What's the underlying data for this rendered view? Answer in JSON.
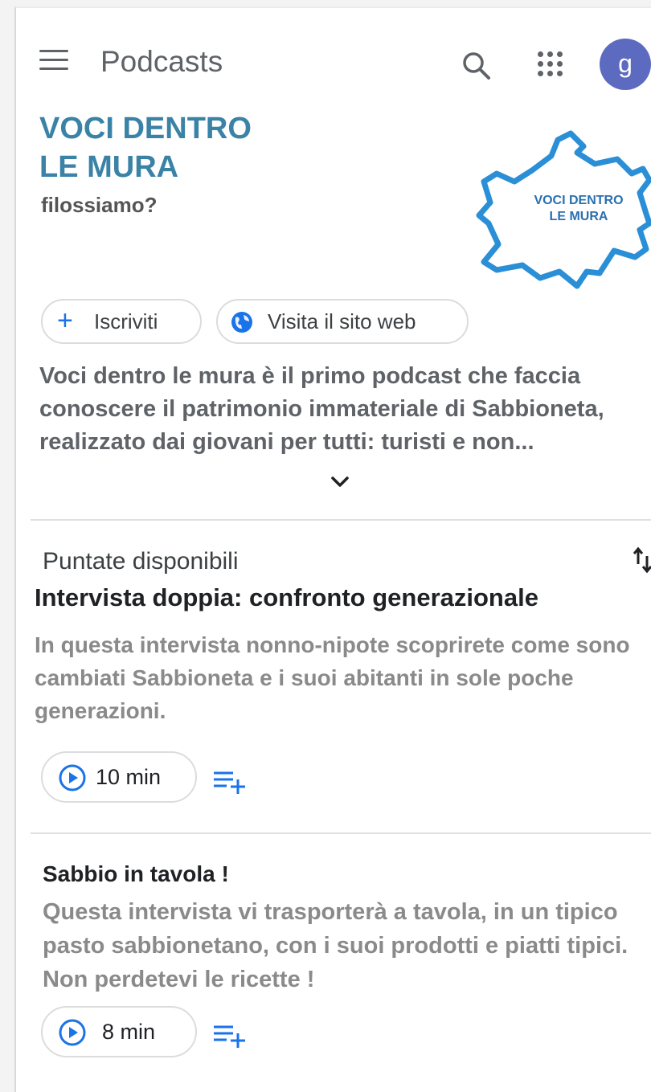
{
  "header": {
    "title": "Podcasts",
    "avatar_letter": "g",
    "avatar_color": "#5c6bc0"
  },
  "podcast": {
    "title": "VOCI DENTRO\nLE MURA",
    "author": "filossiamo?",
    "logo_text": "VOCI DENTRO\nLE MURA",
    "subscribe_label": "Iscriviti",
    "website_label": "Visita il sito web",
    "description": "Voci dentro le mura è il primo podcast che faccia conoscere il patrimonio immateriale di Sabbioneta, realizzato dai giovani per tutti: turisti e non..."
  },
  "episodes_section": {
    "heading": "Puntate disponibili",
    "episodes": [
      {
        "title": "Intervista doppia: confronto generazionale",
        "description": "In questa intervista nonno-nipote scoprirete come sono cambiati Sabbioneta e i suoi abitanti in sole poche generazioni.",
        "duration": "10  min"
      },
      {
        "title": "Sabbio in tavola !",
        "description": "Questa intervista vi trasporterà a tavola, in un tipico pasto sabbionetano, con i suoi prodotti e piatti tipici. Non perdetevi le ricette !",
        "duration": "8  min"
      }
    ]
  },
  "colors": {
    "accent": "#1a73e8",
    "title_teal": "#3a82a6",
    "logo_blue": "#2a8fd6",
    "description_gray": "#8a8a8a"
  },
  "icons": [
    "menu-icon",
    "search-icon",
    "apps-grid-icon",
    "add-icon",
    "globe-icon",
    "chevron-down-icon",
    "sort-icon",
    "play-icon",
    "add-to-queue-icon"
  ]
}
